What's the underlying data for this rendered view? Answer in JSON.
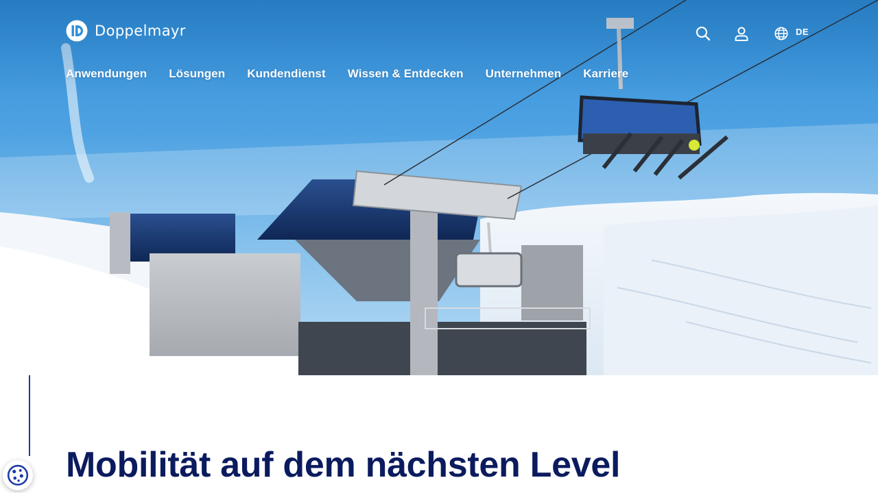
{
  "brand": {
    "name": "Doppelmayr",
    "logo_icon": "doppelmayr-logo-icon"
  },
  "header": {
    "tools": {
      "search_icon": "search-icon",
      "account_icon": "user-icon",
      "language_icon": "globe-icon",
      "language_code": "DE"
    },
    "nav": [
      {
        "label": "Anwendungen"
      },
      {
        "label": "Lösungen"
      },
      {
        "label": "Kundendienst"
      },
      {
        "label": "Wissen & Entdecken"
      },
      {
        "label": "Unternehmen"
      },
      {
        "label": "Karriere"
      }
    ]
  },
  "hero": {
    "image_subject": "chairlift-ski-station-photo"
  },
  "content": {
    "headline": "Mobilität auf dem nächsten Level"
  },
  "cookie": {
    "icon": "cookie-icon"
  },
  "colors": {
    "brand_navy": "#0b1b5e",
    "accent_blue": "#1a3aa8",
    "sky_blue": "#2f8ed8",
    "white": "#ffffff"
  }
}
